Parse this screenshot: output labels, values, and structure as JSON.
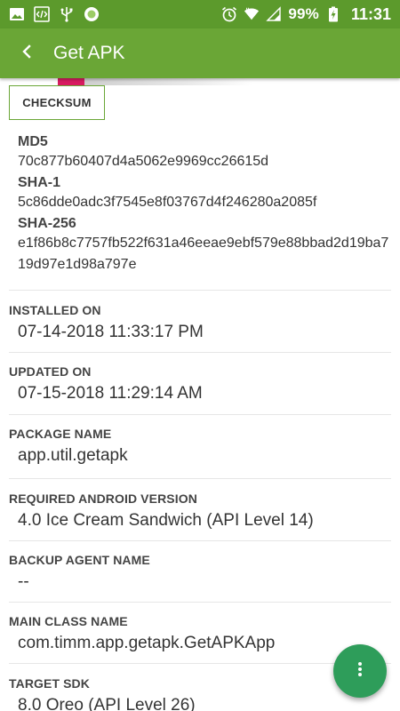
{
  "status_bar": {
    "left_icons": [
      "gallery-icon",
      "code-icon",
      "usb-icon",
      "circle-app-icon"
    ],
    "right_icons": [
      "alarm-icon",
      "wifi-icon",
      "signal-icon",
      "battery-charging-icon"
    ],
    "battery": "99%",
    "time": "11:31"
  },
  "app_bar": {
    "title": "Get APK",
    "back_icon": "back-arrow-icon"
  },
  "checksum": {
    "button_label": "CHECKSUM",
    "md5_label": "MD5",
    "md5_value": "70c877b60407d4a5062e9969cc26615d",
    "sha1_label": "SHA-1",
    "sha1_value": "5c86dde0adc3f7545e8f03767d4f246280a2085f",
    "sha256_label": "SHA-256",
    "sha256_value": "e1f86b8c7757fb522f631a46eeae9ebf579e88bbad2d19ba719d97e1d98a797e"
  },
  "fields": {
    "installed_on": {
      "label": "INSTALLED ON",
      "value": "07-14-2018 11:33:17 PM"
    },
    "updated_on": {
      "label": "UPDATED ON",
      "value": "07-15-2018 11:29:14 AM"
    },
    "package_name": {
      "label": "PACKAGE NAME",
      "value": "app.util.getapk"
    },
    "required_android": {
      "label": "REQUIRED ANDROID VERSION",
      "value": "4.0 Ice Cream Sandwich (API Level 14)"
    },
    "backup_agent": {
      "label": "BACKUP AGENT NAME",
      "value": "--"
    },
    "main_class": {
      "label": "MAIN CLASS NAME",
      "value": "com.timm.app.getapk.GetAPKApp"
    },
    "target_sdk": {
      "label": "TARGET SDK",
      "value": "8.0 Oreo (API Level 26)"
    }
  },
  "fab": {
    "icon": "more-vert-icon"
  },
  "colors": {
    "status_bar": "#5c9a2c",
    "app_bar": "#6aa636",
    "fab": "#2e9d5a",
    "accent_pink": "#d81b60"
  }
}
